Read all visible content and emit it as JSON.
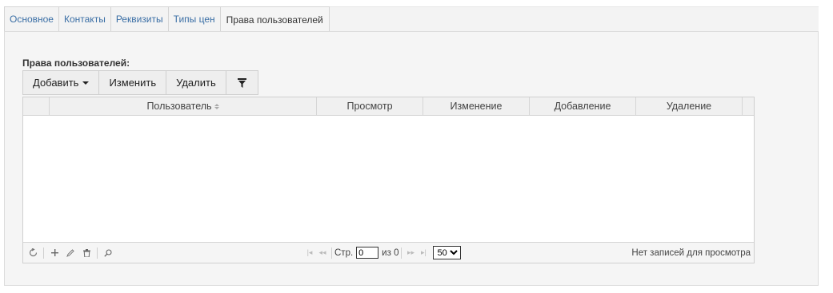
{
  "tabs": [
    {
      "label": "Основное"
    },
    {
      "label": "Контакты"
    },
    {
      "label": "Реквизиты"
    },
    {
      "label": "Типы цен"
    },
    {
      "label": "Права пользователей"
    }
  ],
  "section": {
    "title": "Права пользователей:"
  },
  "toolbar": {
    "add_label": "Добавить",
    "edit_label": "Изменить",
    "delete_label": "Удалить",
    "filter_icon": "filter-icon"
  },
  "grid": {
    "columns": [
      "Пользователь",
      "Просмотр",
      "Изменение",
      "Добавление",
      "Удаление"
    ],
    "sorted_column": "Пользователь",
    "rows": []
  },
  "footer": {
    "page_label": "Стр.",
    "page_value": "0",
    "of_label": "из 0",
    "page_size": "50",
    "page_size_options": [
      "50"
    ],
    "records_info": "Нет записей для просмотра"
  },
  "colors": {
    "tab_link": "#3a6ea5",
    "panel_bg": "#f5f5f5",
    "border": "#cfcfcf"
  }
}
